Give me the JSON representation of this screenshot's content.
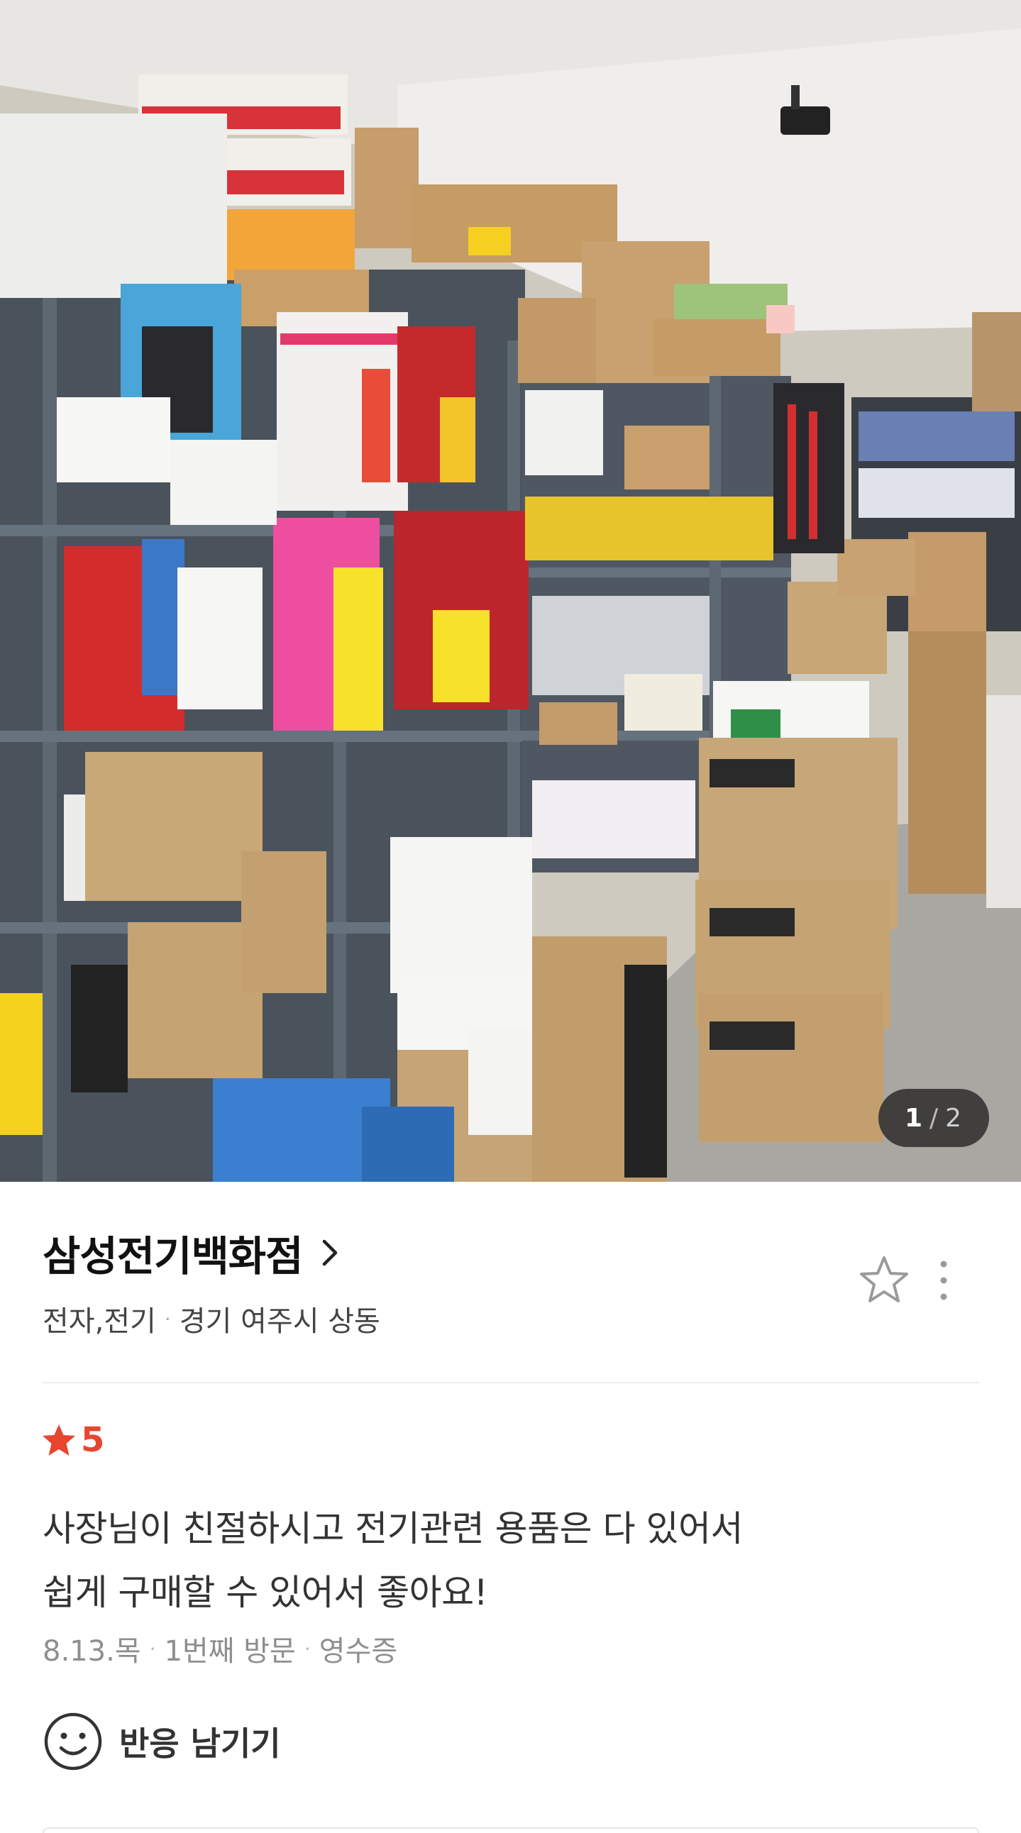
{
  "photo": {
    "counter_current": "1",
    "counter_separator": "/",
    "counter_total": "2"
  },
  "place": {
    "name": "삼성전기백화점",
    "category": "전자,전기",
    "location": "경기 여주시 상동"
  },
  "review": {
    "rating": "5",
    "text_line1": "사장님이 친절하시고 전기관련 용품은 다 있어서",
    "text_line2": "쉽게 구매할 수 있어서 좋아요!",
    "date": "8.13.목",
    "visit": "1번째 방문",
    "proof": "영수증"
  },
  "reaction": {
    "label": "반응 남기기"
  },
  "colors": {
    "rating_red": "#e8452f",
    "counter_bg": "#282828",
    "meta_gray": "#8e8e8e"
  },
  "icons": [
    "chevron-right-icon",
    "star-outline-icon",
    "more-vertical-icon",
    "star-filled-icon",
    "smiley-icon"
  ]
}
